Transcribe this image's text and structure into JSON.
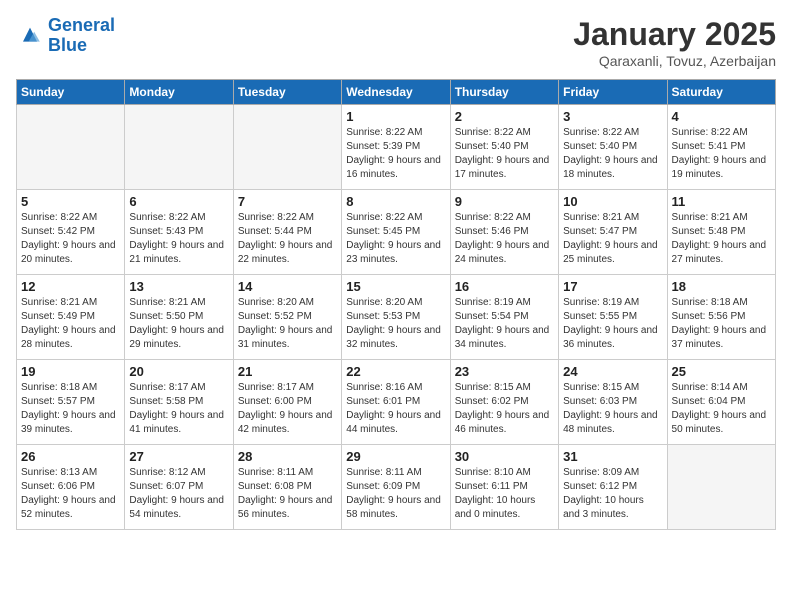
{
  "logo": {
    "line1": "General",
    "line2": "Blue"
  },
  "title": "January 2025",
  "subtitle": "Qaraxanli, Tovuz, Azerbaijan",
  "weekdays": [
    "Sunday",
    "Monday",
    "Tuesday",
    "Wednesday",
    "Thursday",
    "Friday",
    "Saturday"
  ],
  "weeks": [
    [
      {
        "day": "",
        "info": ""
      },
      {
        "day": "",
        "info": ""
      },
      {
        "day": "",
        "info": ""
      },
      {
        "day": "1",
        "sunrise": "8:22 AM",
        "sunset": "5:39 PM",
        "daylight": "9 hours and 16 minutes."
      },
      {
        "day": "2",
        "sunrise": "8:22 AM",
        "sunset": "5:40 PM",
        "daylight": "9 hours and 17 minutes."
      },
      {
        "day": "3",
        "sunrise": "8:22 AM",
        "sunset": "5:40 PM",
        "daylight": "9 hours and 18 minutes."
      },
      {
        "day": "4",
        "sunrise": "8:22 AM",
        "sunset": "5:41 PM",
        "daylight": "9 hours and 19 minutes."
      }
    ],
    [
      {
        "day": "5",
        "sunrise": "8:22 AM",
        "sunset": "5:42 PM",
        "daylight": "9 hours and 20 minutes."
      },
      {
        "day": "6",
        "sunrise": "8:22 AM",
        "sunset": "5:43 PM",
        "daylight": "9 hours and 21 minutes."
      },
      {
        "day": "7",
        "sunrise": "8:22 AM",
        "sunset": "5:44 PM",
        "daylight": "9 hours and 22 minutes."
      },
      {
        "day": "8",
        "sunrise": "8:22 AM",
        "sunset": "5:45 PM",
        "daylight": "9 hours and 23 minutes."
      },
      {
        "day": "9",
        "sunrise": "8:22 AM",
        "sunset": "5:46 PM",
        "daylight": "9 hours and 24 minutes."
      },
      {
        "day": "10",
        "sunrise": "8:21 AM",
        "sunset": "5:47 PM",
        "daylight": "9 hours and 25 minutes."
      },
      {
        "day": "11",
        "sunrise": "8:21 AM",
        "sunset": "5:48 PM",
        "daylight": "9 hours and 27 minutes."
      }
    ],
    [
      {
        "day": "12",
        "sunrise": "8:21 AM",
        "sunset": "5:49 PM",
        "daylight": "9 hours and 28 minutes."
      },
      {
        "day": "13",
        "sunrise": "8:21 AM",
        "sunset": "5:50 PM",
        "daylight": "9 hours and 29 minutes."
      },
      {
        "day": "14",
        "sunrise": "8:20 AM",
        "sunset": "5:52 PM",
        "daylight": "9 hours and 31 minutes."
      },
      {
        "day": "15",
        "sunrise": "8:20 AM",
        "sunset": "5:53 PM",
        "daylight": "9 hours and 32 minutes."
      },
      {
        "day": "16",
        "sunrise": "8:19 AM",
        "sunset": "5:54 PM",
        "daylight": "9 hours and 34 minutes."
      },
      {
        "day": "17",
        "sunrise": "8:19 AM",
        "sunset": "5:55 PM",
        "daylight": "9 hours and 36 minutes."
      },
      {
        "day": "18",
        "sunrise": "8:18 AM",
        "sunset": "5:56 PM",
        "daylight": "9 hours and 37 minutes."
      }
    ],
    [
      {
        "day": "19",
        "sunrise": "8:18 AM",
        "sunset": "5:57 PM",
        "daylight": "9 hours and 39 minutes."
      },
      {
        "day": "20",
        "sunrise": "8:17 AM",
        "sunset": "5:58 PM",
        "daylight": "9 hours and 41 minutes."
      },
      {
        "day": "21",
        "sunrise": "8:17 AM",
        "sunset": "6:00 PM",
        "daylight": "9 hours and 42 minutes."
      },
      {
        "day": "22",
        "sunrise": "8:16 AM",
        "sunset": "6:01 PM",
        "daylight": "9 hours and 44 minutes."
      },
      {
        "day": "23",
        "sunrise": "8:15 AM",
        "sunset": "6:02 PM",
        "daylight": "9 hours and 46 minutes."
      },
      {
        "day": "24",
        "sunrise": "8:15 AM",
        "sunset": "6:03 PM",
        "daylight": "9 hours and 48 minutes."
      },
      {
        "day": "25",
        "sunrise": "8:14 AM",
        "sunset": "6:04 PM",
        "daylight": "9 hours and 50 minutes."
      }
    ],
    [
      {
        "day": "26",
        "sunrise": "8:13 AM",
        "sunset": "6:06 PM",
        "daylight": "9 hours and 52 minutes."
      },
      {
        "day": "27",
        "sunrise": "8:12 AM",
        "sunset": "6:07 PM",
        "daylight": "9 hours and 54 minutes."
      },
      {
        "day": "28",
        "sunrise": "8:11 AM",
        "sunset": "6:08 PM",
        "daylight": "9 hours and 56 minutes."
      },
      {
        "day": "29",
        "sunrise": "8:11 AM",
        "sunset": "6:09 PM",
        "daylight": "9 hours and 58 minutes."
      },
      {
        "day": "30",
        "sunrise": "8:10 AM",
        "sunset": "6:11 PM",
        "daylight": "10 hours and 0 minutes."
      },
      {
        "day": "31",
        "sunrise": "8:09 AM",
        "sunset": "6:12 PM",
        "daylight": "10 hours and 3 minutes."
      },
      {
        "day": "",
        "info": ""
      }
    ]
  ]
}
